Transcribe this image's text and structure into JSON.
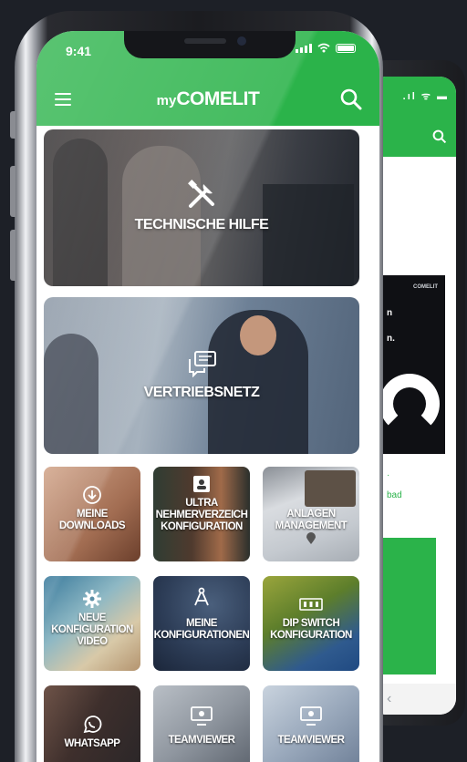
{
  "status_bar": {
    "time": "9:41"
  },
  "header": {
    "logo_prefix": "my",
    "logo_brand": "COMELIT",
    "menu_icon": "hamburger-icon",
    "search_icon": "search-icon"
  },
  "banners": [
    {
      "label": "TECHNISCHE HILFE",
      "icon": "tools-icon"
    },
    {
      "label": "VERTRIEBSNETZ",
      "icon": "chat-bubbles-icon"
    }
  ],
  "tiles": [
    {
      "line1": "MEINE",
      "line2": "DOWNLOADS",
      "line3": "",
      "icon": "download-icon"
    },
    {
      "line1": "ULTRA",
      "line2": "NEHMERVERZEICH",
      "line3": "KONFIGURATION",
      "icon": "contact-card-icon"
    },
    {
      "line1": "ANLAGEN",
      "line2": "MANAGEMENT",
      "line3": "",
      "icon": "map-pin-icon"
    },
    {
      "line1": "NEUE",
      "line2": "KONFIGURATION",
      "line3": "VIDEO",
      "icon": "gear-icon"
    },
    {
      "line1": "MEINE",
      "line2": "KONFIGURATIONEN",
      "line3": "",
      "icon": "compass-icon"
    },
    {
      "line1": "DIP SWITCH",
      "line2": "KONFIGURATION",
      "line3": "",
      "icon": "dip-switch-icon"
    },
    {
      "line1": "WHATSAPP",
      "line2": "",
      "line3": "",
      "icon": "whatsapp-icon"
    },
    {
      "line1": "TEAMVIEWER",
      "line2": "",
      "line3": "",
      "icon": "teamviewer-icon"
    },
    {
      "line1": "TEAMVIEWER",
      "line2": "",
      "line3": "",
      "icon": "teamviewer-icon"
    }
  ],
  "back_phone": {
    "brand": "COMELIT",
    "line1": "n",
    "line2": "n.",
    "link_text": "bad"
  },
  "colors": {
    "brand_green": "#2bb34a",
    "bg": "#1d2027"
  }
}
